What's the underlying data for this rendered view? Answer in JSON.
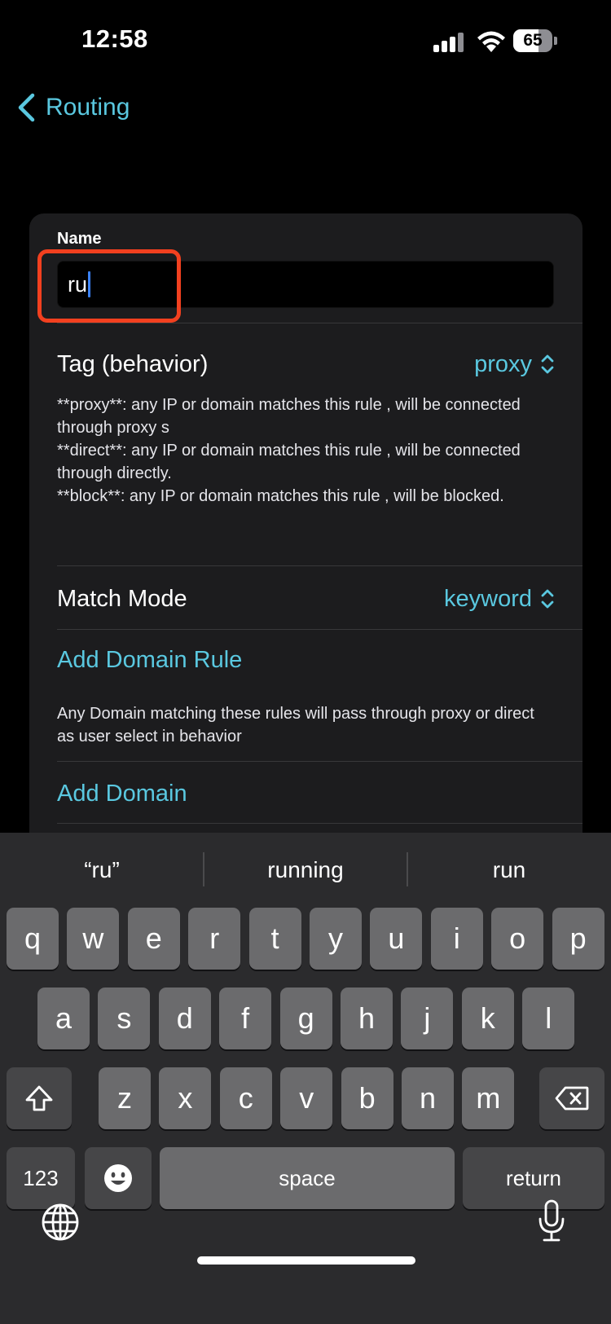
{
  "status_bar": {
    "time": "12:58",
    "battery_level": "65",
    "battery_fraction": 0.65
  },
  "nav": {
    "back_label": "Routing"
  },
  "form": {
    "name_label": "Name",
    "name_value": "ru",
    "tag": {
      "label": "Tag (behavior)",
      "value": "proxy"
    },
    "tag_description": [
      "**proxy**: any IP or domain matches this rule , will be connected through proxy s",
      "**direct**: any IP or domain matches this rule , will be connected through directly.",
      "**block**: any IP or domain matches this rule , will be blocked."
    ],
    "match_mode": {
      "label": "Match Mode",
      "value": "keyword"
    },
    "add_domain_rule_label": "Add Domain Rule",
    "domain_description": "Any Domain matching these rules will pass through proxy or direct as user select in behavior",
    "add_domain_label": "Add Domain"
  },
  "keyboard": {
    "suggestions": [
      "“ru”",
      "running",
      "run"
    ],
    "row1": [
      "q",
      "w",
      "e",
      "r",
      "t",
      "y",
      "u",
      "i",
      "o",
      "p"
    ],
    "row2": [
      "a",
      "s",
      "d",
      "f",
      "g",
      "h",
      "j",
      "k",
      "l"
    ],
    "row3": [
      "z",
      "x",
      "c",
      "v",
      "b",
      "n",
      "m"
    ],
    "numbers_label": "123",
    "space_label": "space",
    "return_label": "return"
  },
  "colors": {
    "accent": "#5ac8e0",
    "highlight": "#f2401f",
    "card": "#1c1c1e",
    "key": "#6b6b6d",
    "key_dark": "#464648"
  }
}
